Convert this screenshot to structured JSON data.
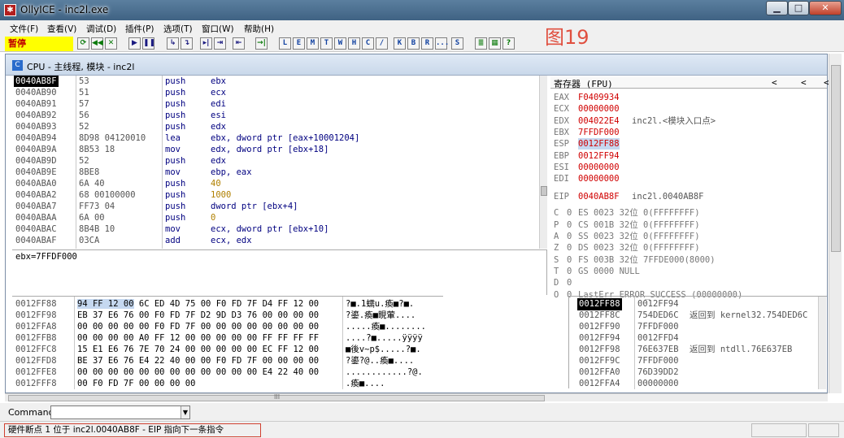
{
  "window": {
    "title": "OllyICE - inc2l.exe",
    "icon": "olly-app-icon"
  },
  "caption_buttons": {
    "minimize": "▁",
    "maximize": "□",
    "close": "✕"
  },
  "menu": [
    "文件(F)",
    "查看(V)",
    "调试(D)",
    "插件(P)",
    "选项(T)",
    "窗口(W)",
    "帮助(H)"
  ],
  "toolbar": {
    "status": "暂停",
    "buttons": [
      "⟳",
      "◀◀",
      "✕",
      "▶",
      "❚❚",
      "↳",
      "↴",
      "▸|",
      "⇥",
      "⇤",
      "→|"
    ],
    "letter_buttons": [
      "L",
      "E",
      "M",
      "T",
      "W",
      "H",
      "C",
      "/",
      "K",
      "B",
      "R",
      "...",
      "S"
    ],
    "extra_buttons": [
      "≣",
      "▦",
      "?"
    ]
  },
  "watermark": "图19",
  "cpu": {
    "title": "CPU - 主线程, 模块 - inc2l"
  },
  "disasm": [
    {
      "addr": "0040AB8F",
      "hex": "53",
      "mn": "push",
      "op": "ebx",
      "sel": true
    },
    {
      "addr": "0040AB90",
      "hex": "51",
      "mn": "push",
      "op": "ecx"
    },
    {
      "addr": "0040AB91",
      "hex": "57",
      "mn": "push",
      "op": "edi"
    },
    {
      "addr": "0040AB92",
      "hex": "56",
      "mn": "push",
      "op": "esi"
    },
    {
      "addr": "0040AB93",
      "hex": "52",
      "mn": "push",
      "op": "edx"
    },
    {
      "addr": "0040AB94",
      "hex": "8D98 04120010",
      "mn": "lea",
      "op": "ebx, dword ptr [eax+10001204]"
    },
    {
      "addr": "0040AB9A",
      "hex": "8B53 18",
      "mn": "mov",
      "op": "edx, dword ptr [ebx+18]"
    },
    {
      "addr": "0040AB9D",
      "hex": "52",
      "mn": "push",
      "op": "edx"
    },
    {
      "addr": "0040AB9E",
      "hex": "8BE8",
      "mn": "mov",
      "op": "ebp, eax"
    },
    {
      "addr": "0040ABA0",
      "hex": "6A 40",
      "mn": "push",
      "op": "40",
      "num": true
    },
    {
      "addr": "0040ABA2",
      "hex": "68 00100000",
      "mn": "push",
      "op": "1000",
      "num": true
    },
    {
      "addr": "0040ABA7",
      "hex": "FF73 04",
      "mn": "push",
      "op": "dword ptr [ebx+4]"
    },
    {
      "addr": "0040ABAA",
      "hex": "6A 00",
      "mn": "push",
      "op": "0",
      "num": true
    },
    {
      "addr": "0040ABAC",
      "hex": "8B4B 10",
      "mn": "mov",
      "op": "ecx, dword ptr [ebx+10]"
    },
    {
      "addr": "0040ABAF",
      "hex": "03CA",
      "mn": "add",
      "op": "ecx, edx"
    }
  ],
  "info_line": "ebx=7FFDF000",
  "registers": {
    "header": "寄存器 (FPU)",
    "nav": [
      "<",
      "<",
      "<"
    ],
    "general": [
      {
        "name": "EAX",
        "value": "F0409934",
        "comment": ""
      },
      {
        "name": "ECX",
        "value": "00000000",
        "comment": ""
      },
      {
        "name": "EDX",
        "value": "004022E4",
        "comment": "inc2l.<模块入口点>"
      },
      {
        "name": "EBX",
        "value": "7FFDF000",
        "comment": ""
      },
      {
        "name": "ESP",
        "value": "0012FF88",
        "comment": "",
        "sel": true
      },
      {
        "name": "EBP",
        "value": "0012FF94",
        "comment": ""
      },
      {
        "name": "ESI",
        "value": "00000000",
        "comment": ""
      },
      {
        "name": "EDI",
        "value": "00000000",
        "comment": ""
      }
    ],
    "eip": {
      "name": "EIP",
      "value": "0040AB8F",
      "comment": "inc2l.0040AB8F"
    },
    "flags": [
      {
        "f": "C",
        "v": "0",
        "seg": "ES 0023 32位 0(FFFFFFFF)"
      },
      {
        "f": "P",
        "v": "0",
        "seg": "CS 001B 32位 0(FFFFFFFF)"
      },
      {
        "f": "A",
        "v": "0",
        "seg": "SS 0023 32位 0(FFFFFFFF)"
      },
      {
        "f": "Z",
        "v": "0",
        "seg": "DS 0023 32位 0(FFFFFFFF)"
      },
      {
        "f": "S",
        "v": "0",
        "seg": "FS 003B 32位 7FFDE000(8000)"
      },
      {
        "f": "T",
        "v": "0",
        "seg": "GS 0000 NULL"
      },
      {
        "f": "D",
        "v": "0",
        "seg": ""
      },
      {
        "f": "O",
        "v": "0",
        "seg": "LastErr ERROR_SUCCESS (00000000)"
      }
    ]
  },
  "dump": [
    {
      "addr": "0012FF88",
      "hex_hl": "94 FF 12 00",
      "hex": " 6C ED 4D 75 00 F0 FD 7F D4 FF 12 00",
      "ascii": "?■.1蠕u.瘓■?■."
    },
    {
      "addr": "0012FF98",
      "hex_hl": "",
      "hex": "EB 37 E6 76 00 F0 FD 7F D2 9D D3 76 00 00 00 00",
      "ascii": "?鎏.瘓■睍葷...."
    },
    {
      "addr": "0012FFA8",
      "hex_hl": "",
      "hex": "00 00 00 00 00 F0 FD 7F 00 00 00 00 00 00 00 00",
      "ascii": ".....瘓■........"
    },
    {
      "addr": "0012FFB8",
      "hex_hl": "",
      "hex": "00 00 00 00 A0 FF 12 00 00 00 00 00 FF FF FF FF",
      "ascii": "....?■.....ÿÿÿÿ"
    },
    {
      "addr": "0012FFC8",
      "hex_hl": "",
      "hex": "15 E1 E6 76 7E 70 24 00 00 00 00 00 EC FF 12 00",
      "ascii": "■後v~p$.....?■."
    },
    {
      "addr": "0012FFD8",
      "hex_hl": "",
      "hex": "BE 37 E6 76 E4 22 40 00 00 F0 FD 7F 00 00 00 00",
      "ascii": "?鎏?@..瘓■...."
    },
    {
      "addr": "0012FFE8",
      "hex_hl": "",
      "hex": "00 00 00 00 00 00 00 00 00 00 00 00 E4 22 40 00",
      "ascii": "............?@."
    },
    {
      "addr": "0012FFF8",
      "hex_hl": "",
      "hex": "00 F0 FD 7F 00 00 00 00",
      "ascii": ".瘓■...."
    }
  ],
  "stack": [
    {
      "addr": "0012FF88",
      "val": "0012FF94",
      "com": "",
      "sel": true
    },
    {
      "addr": "0012FF8C",
      "val": "754DED6C",
      "com": "返回到 kernel32.754DED6C"
    },
    {
      "addr": "0012FF90",
      "val": "7FFDF000",
      "com": ""
    },
    {
      "addr": "0012FF94",
      "val": "0012FFD4",
      "com": ""
    },
    {
      "addr": "0012FF98",
      "val": "76E637EB",
      "com": "返回到 ntdll.76E637EB"
    },
    {
      "addr": "0012FF9C",
      "val": "7FFDF000",
      "com": ""
    },
    {
      "addr": "0012FFA0",
      "val": "76D39DD2",
      "com": ""
    },
    {
      "addr": "0012FFA4",
      "val": "00000000",
      "com": ""
    }
  ],
  "hscroll_label": "III",
  "command": {
    "label": "Command",
    "value": ""
  },
  "statusbar": {
    "text": "硬件断点 1 位于 inc2l.0040AB8F - EIP 指向下一条指令"
  }
}
